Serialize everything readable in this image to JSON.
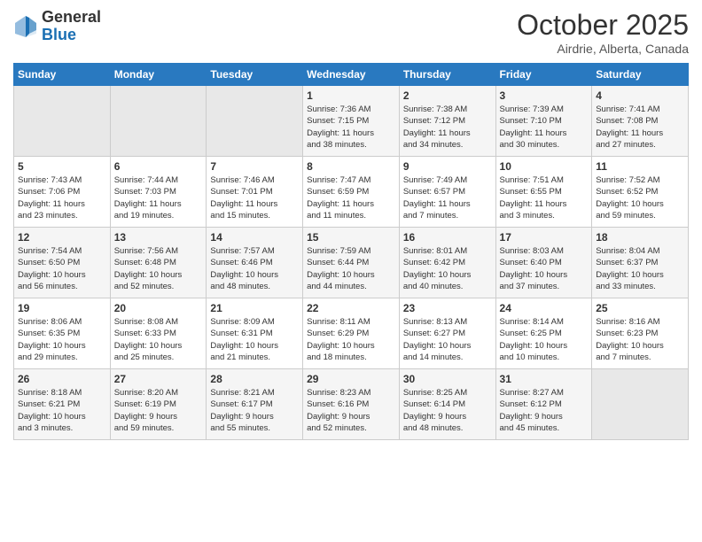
{
  "header": {
    "logo_general": "General",
    "logo_blue": "Blue",
    "title": "October 2025",
    "location": "Airdrie, Alberta, Canada"
  },
  "weekdays": [
    "Sunday",
    "Monday",
    "Tuesday",
    "Wednesday",
    "Thursday",
    "Friday",
    "Saturday"
  ],
  "weeks": [
    [
      {
        "day": "",
        "info": ""
      },
      {
        "day": "",
        "info": ""
      },
      {
        "day": "",
        "info": ""
      },
      {
        "day": "1",
        "info": "Sunrise: 7:36 AM\nSunset: 7:15 PM\nDaylight: 11 hours\nand 38 minutes."
      },
      {
        "day": "2",
        "info": "Sunrise: 7:38 AM\nSunset: 7:12 PM\nDaylight: 11 hours\nand 34 minutes."
      },
      {
        "day": "3",
        "info": "Sunrise: 7:39 AM\nSunset: 7:10 PM\nDaylight: 11 hours\nand 30 minutes."
      },
      {
        "day": "4",
        "info": "Sunrise: 7:41 AM\nSunset: 7:08 PM\nDaylight: 11 hours\nand 27 minutes."
      }
    ],
    [
      {
        "day": "5",
        "info": "Sunrise: 7:43 AM\nSunset: 7:06 PM\nDaylight: 11 hours\nand 23 minutes."
      },
      {
        "day": "6",
        "info": "Sunrise: 7:44 AM\nSunset: 7:03 PM\nDaylight: 11 hours\nand 19 minutes."
      },
      {
        "day": "7",
        "info": "Sunrise: 7:46 AM\nSunset: 7:01 PM\nDaylight: 11 hours\nand 15 minutes."
      },
      {
        "day": "8",
        "info": "Sunrise: 7:47 AM\nSunset: 6:59 PM\nDaylight: 11 hours\nand 11 minutes."
      },
      {
        "day": "9",
        "info": "Sunrise: 7:49 AM\nSunset: 6:57 PM\nDaylight: 11 hours\nand 7 minutes."
      },
      {
        "day": "10",
        "info": "Sunrise: 7:51 AM\nSunset: 6:55 PM\nDaylight: 11 hours\nand 3 minutes."
      },
      {
        "day": "11",
        "info": "Sunrise: 7:52 AM\nSunset: 6:52 PM\nDaylight: 10 hours\nand 59 minutes."
      }
    ],
    [
      {
        "day": "12",
        "info": "Sunrise: 7:54 AM\nSunset: 6:50 PM\nDaylight: 10 hours\nand 56 minutes."
      },
      {
        "day": "13",
        "info": "Sunrise: 7:56 AM\nSunset: 6:48 PM\nDaylight: 10 hours\nand 52 minutes."
      },
      {
        "day": "14",
        "info": "Sunrise: 7:57 AM\nSunset: 6:46 PM\nDaylight: 10 hours\nand 48 minutes."
      },
      {
        "day": "15",
        "info": "Sunrise: 7:59 AM\nSunset: 6:44 PM\nDaylight: 10 hours\nand 44 minutes."
      },
      {
        "day": "16",
        "info": "Sunrise: 8:01 AM\nSunset: 6:42 PM\nDaylight: 10 hours\nand 40 minutes."
      },
      {
        "day": "17",
        "info": "Sunrise: 8:03 AM\nSunset: 6:40 PM\nDaylight: 10 hours\nand 37 minutes."
      },
      {
        "day": "18",
        "info": "Sunrise: 8:04 AM\nSunset: 6:37 PM\nDaylight: 10 hours\nand 33 minutes."
      }
    ],
    [
      {
        "day": "19",
        "info": "Sunrise: 8:06 AM\nSunset: 6:35 PM\nDaylight: 10 hours\nand 29 minutes."
      },
      {
        "day": "20",
        "info": "Sunrise: 8:08 AM\nSunset: 6:33 PM\nDaylight: 10 hours\nand 25 minutes."
      },
      {
        "day": "21",
        "info": "Sunrise: 8:09 AM\nSunset: 6:31 PM\nDaylight: 10 hours\nand 21 minutes."
      },
      {
        "day": "22",
        "info": "Sunrise: 8:11 AM\nSunset: 6:29 PM\nDaylight: 10 hours\nand 18 minutes."
      },
      {
        "day": "23",
        "info": "Sunrise: 8:13 AM\nSunset: 6:27 PM\nDaylight: 10 hours\nand 14 minutes."
      },
      {
        "day": "24",
        "info": "Sunrise: 8:14 AM\nSunset: 6:25 PM\nDaylight: 10 hours\nand 10 minutes."
      },
      {
        "day": "25",
        "info": "Sunrise: 8:16 AM\nSunset: 6:23 PM\nDaylight: 10 hours\nand 7 minutes."
      }
    ],
    [
      {
        "day": "26",
        "info": "Sunrise: 8:18 AM\nSunset: 6:21 PM\nDaylight: 10 hours\nand 3 minutes."
      },
      {
        "day": "27",
        "info": "Sunrise: 8:20 AM\nSunset: 6:19 PM\nDaylight: 9 hours\nand 59 minutes."
      },
      {
        "day": "28",
        "info": "Sunrise: 8:21 AM\nSunset: 6:17 PM\nDaylight: 9 hours\nand 55 minutes."
      },
      {
        "day": "29",
        "info": "Sunrise: 8:23 AM\nSunset: 6:16 PM\nDaylight: 9 hours\nand 52 minutes."
      },
      {
        "day": "30",
        "info": "Sunrise: 8:25 AM\nSunset: 6:14 PM\nDaylight: 9 hours\nand 48 minutes."
      },
      {
        "day": "31",
        "info": "Sunrise: 8:27 AM\nSunset: 6:12 PM\nDaylight: 9 hours\nand 45 minutes."
      },
      {
        "day": "",
        "info": ""
      }
    ]
  ]
}
